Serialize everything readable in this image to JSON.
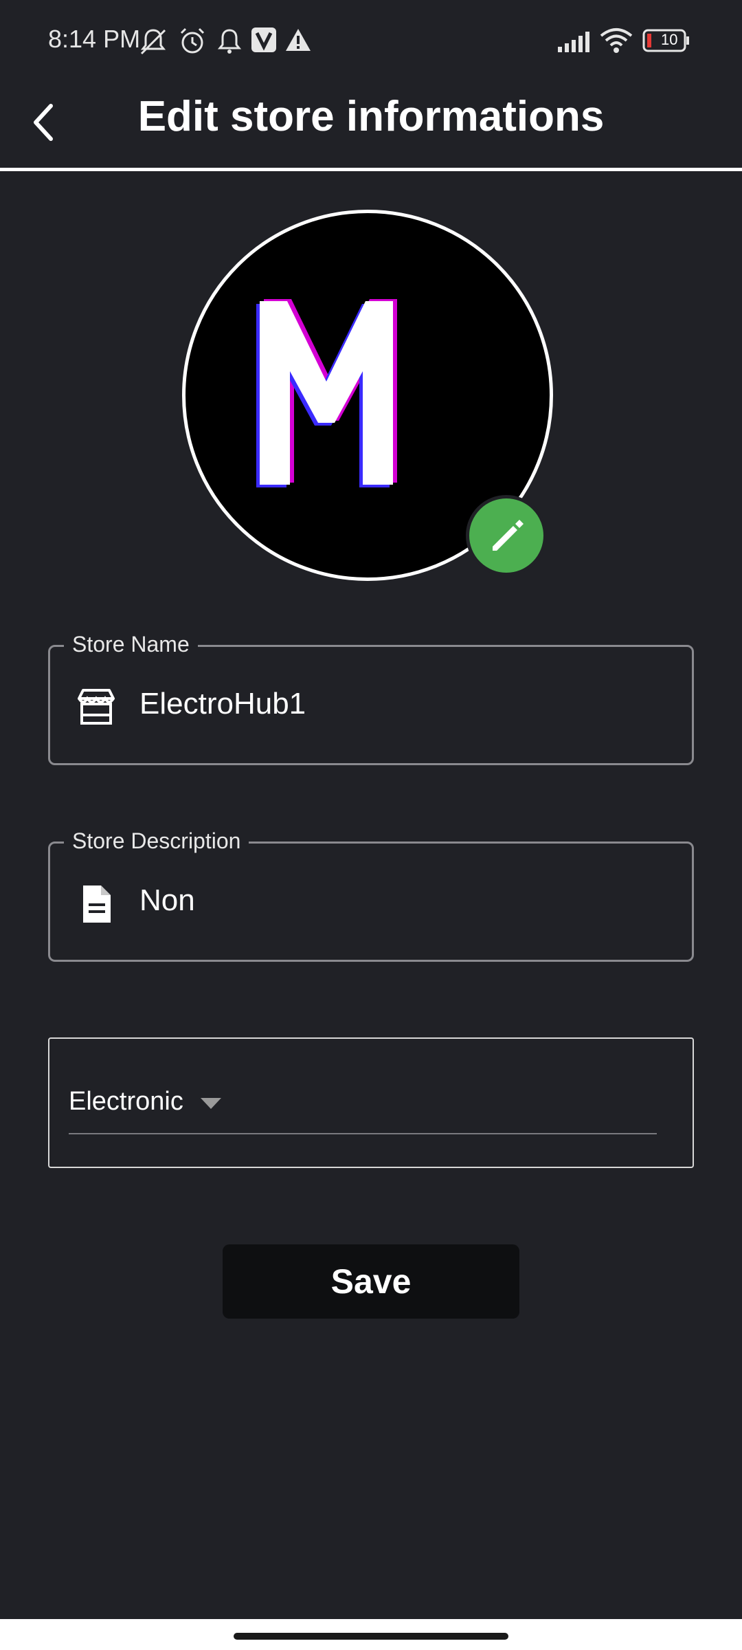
{
  "status_bar": {
    "time": "8:14 PM",
    "battery": "10",
    "icons": [
      "mute-icon",
      "alarm-icon",
      "notification-bell-icon",
      "v-app-icon",
      "warning-icon",
      "signal-icon",
      "wifi-icon",
      "battery-icon"
    ]
  },
  "app_bar": {
    "title": "Edit store informations",
    "back_icon": "chevron-left-icon"
  },
  "avatar": {
    "letter": "M",
    "edit_icon": "pencil-icon",
    "edit_button_color": "#4caf50"
  },
  "form": {
    "store_name": {
      "label": "Store Name",
      "value": "ElectroHub1",
      "icon": "store-icon"
    },
    "store_description": {
      "label": "Store Description",
      "value": "Non",
      "icon": "document-icon"
    },
    "category": {
      "selected": "Electronic"
    },
    "save_label": "Save"
  },
  "colors": {
    "background": "#202126",
    "accent_green": "#4caf50",
    "field_border": "#8a8a8f"
  }
}
